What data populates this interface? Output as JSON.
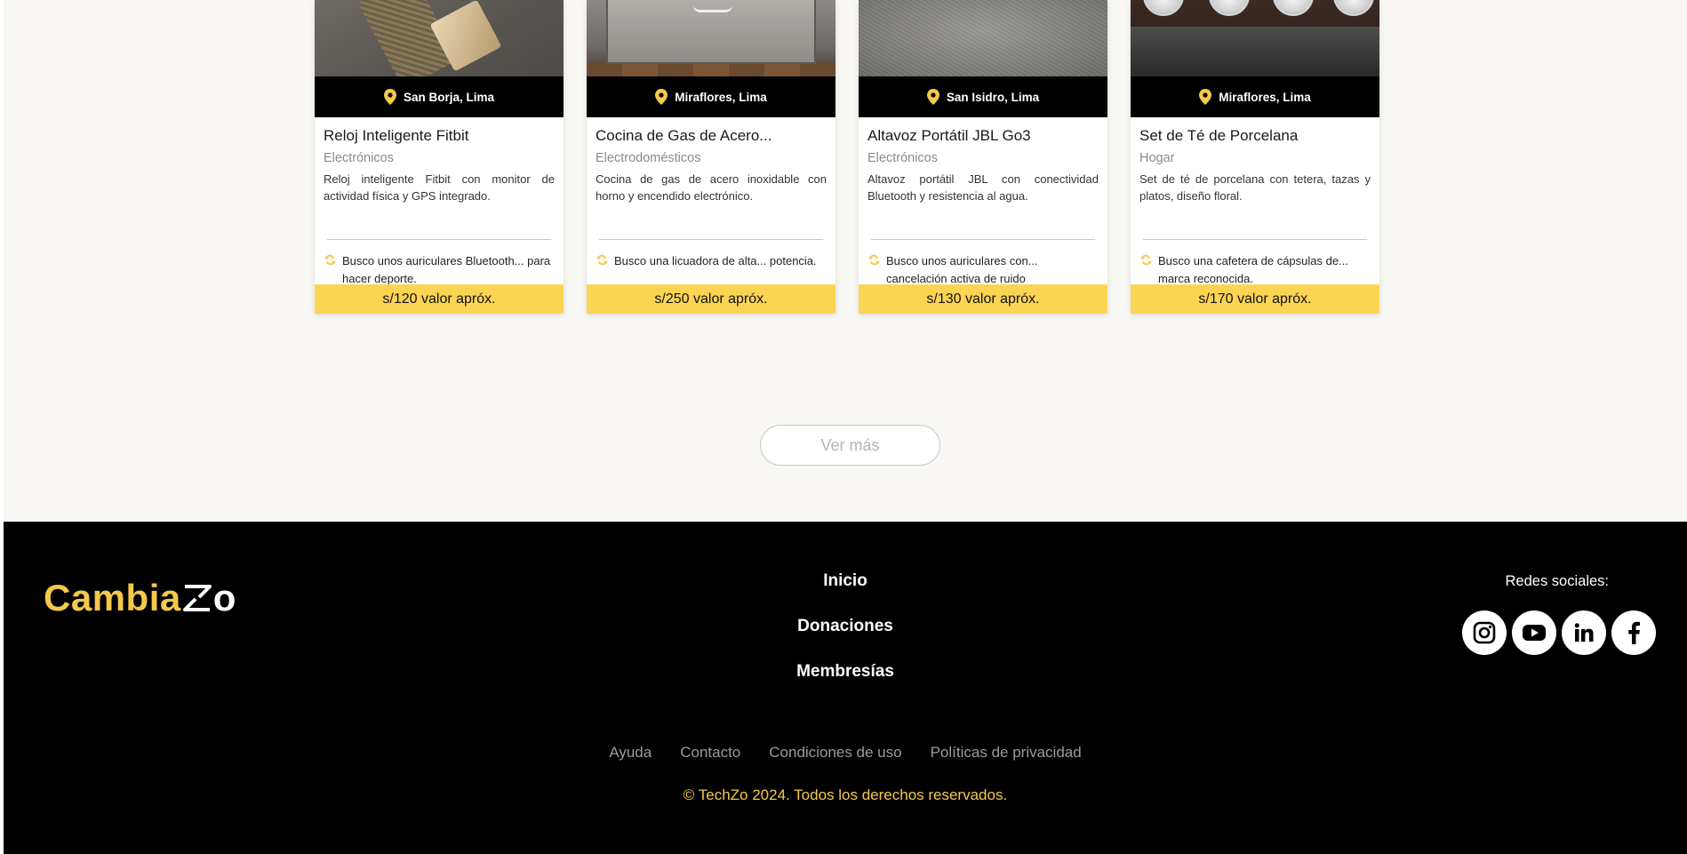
{
  "cards": [
    {
      "location": "San Borja, Lima",
      "title": "Reloj Inteligente Fitbit",
      "category": "Electrónicos",
      "description": "Reloj inteligente Fitbit con monitor de actividad física y GPS integrado.",
      "wish": "Busco unos auriculares Bluetooth... para hacer deporte.",
      "price": "s/120 valor apróx."
    },
    {
      "location": "Miraflores, Lima",
      "title": "Cocina de Gas de Acero...",
      "category": "Electrodomésticos",
      "description": "Cocina de gas de acero inoxidable con horno y encendido electrónico.",
      "wish": "Busco una licuadora de alta... potencia.",
      "price": "s/250 valor apróx."
    },
    {
      "location": "San Isidro, Lima",
      "title": "Altavoz Portátil JBL Go3",
      "category": "Electrónicos",
      "description": "Altavoz portátil JBL con conectividad Bluetooth y resistencia al agua.",
      "wish": "Busco unos auriculares con... cancelación activa de ruido",
      "price": "s/130 valor apróx."
    },
    {
      "location": "Miraflores, Lima",
      "title": "Set de Té de Porcelana",
      "category": "Hogar",
      "description": "Set de té de porcelana con tetera, tazas y platos, diseño floral.",
      "wish": "Busco una cafetera de cápsulas de... marca reconocida.",
      "price": "s/170 valor apróx."
    }
  ],
  "more_button": "Ver más",
  "footer": {
    "logo_text": "Cambia",
    "logo_suffix": "o",
    "nav": [
      "Inicio",
      "Donaciones",
      "Membresías"
    ],
    "links": [
      "Ayuda",
      "Contacto",
      "Condiciones de uso",
      "Políticas de privacidad"
    ],
    "copyright": "© TechZo 2024. Todos los derechos reservados.",
    "social_label": "Redes sociales:",
    "social_icons": [
      "instagram-icon",
      "youtube-icon",
      "linkedin-icon",
      "facebook-icon"
    ]
  },
  "colors": {
    "accent": "#fcd454",
    "footer_bg": "#000000",
    "page_bg": "#f8f7f4"
  }
}
